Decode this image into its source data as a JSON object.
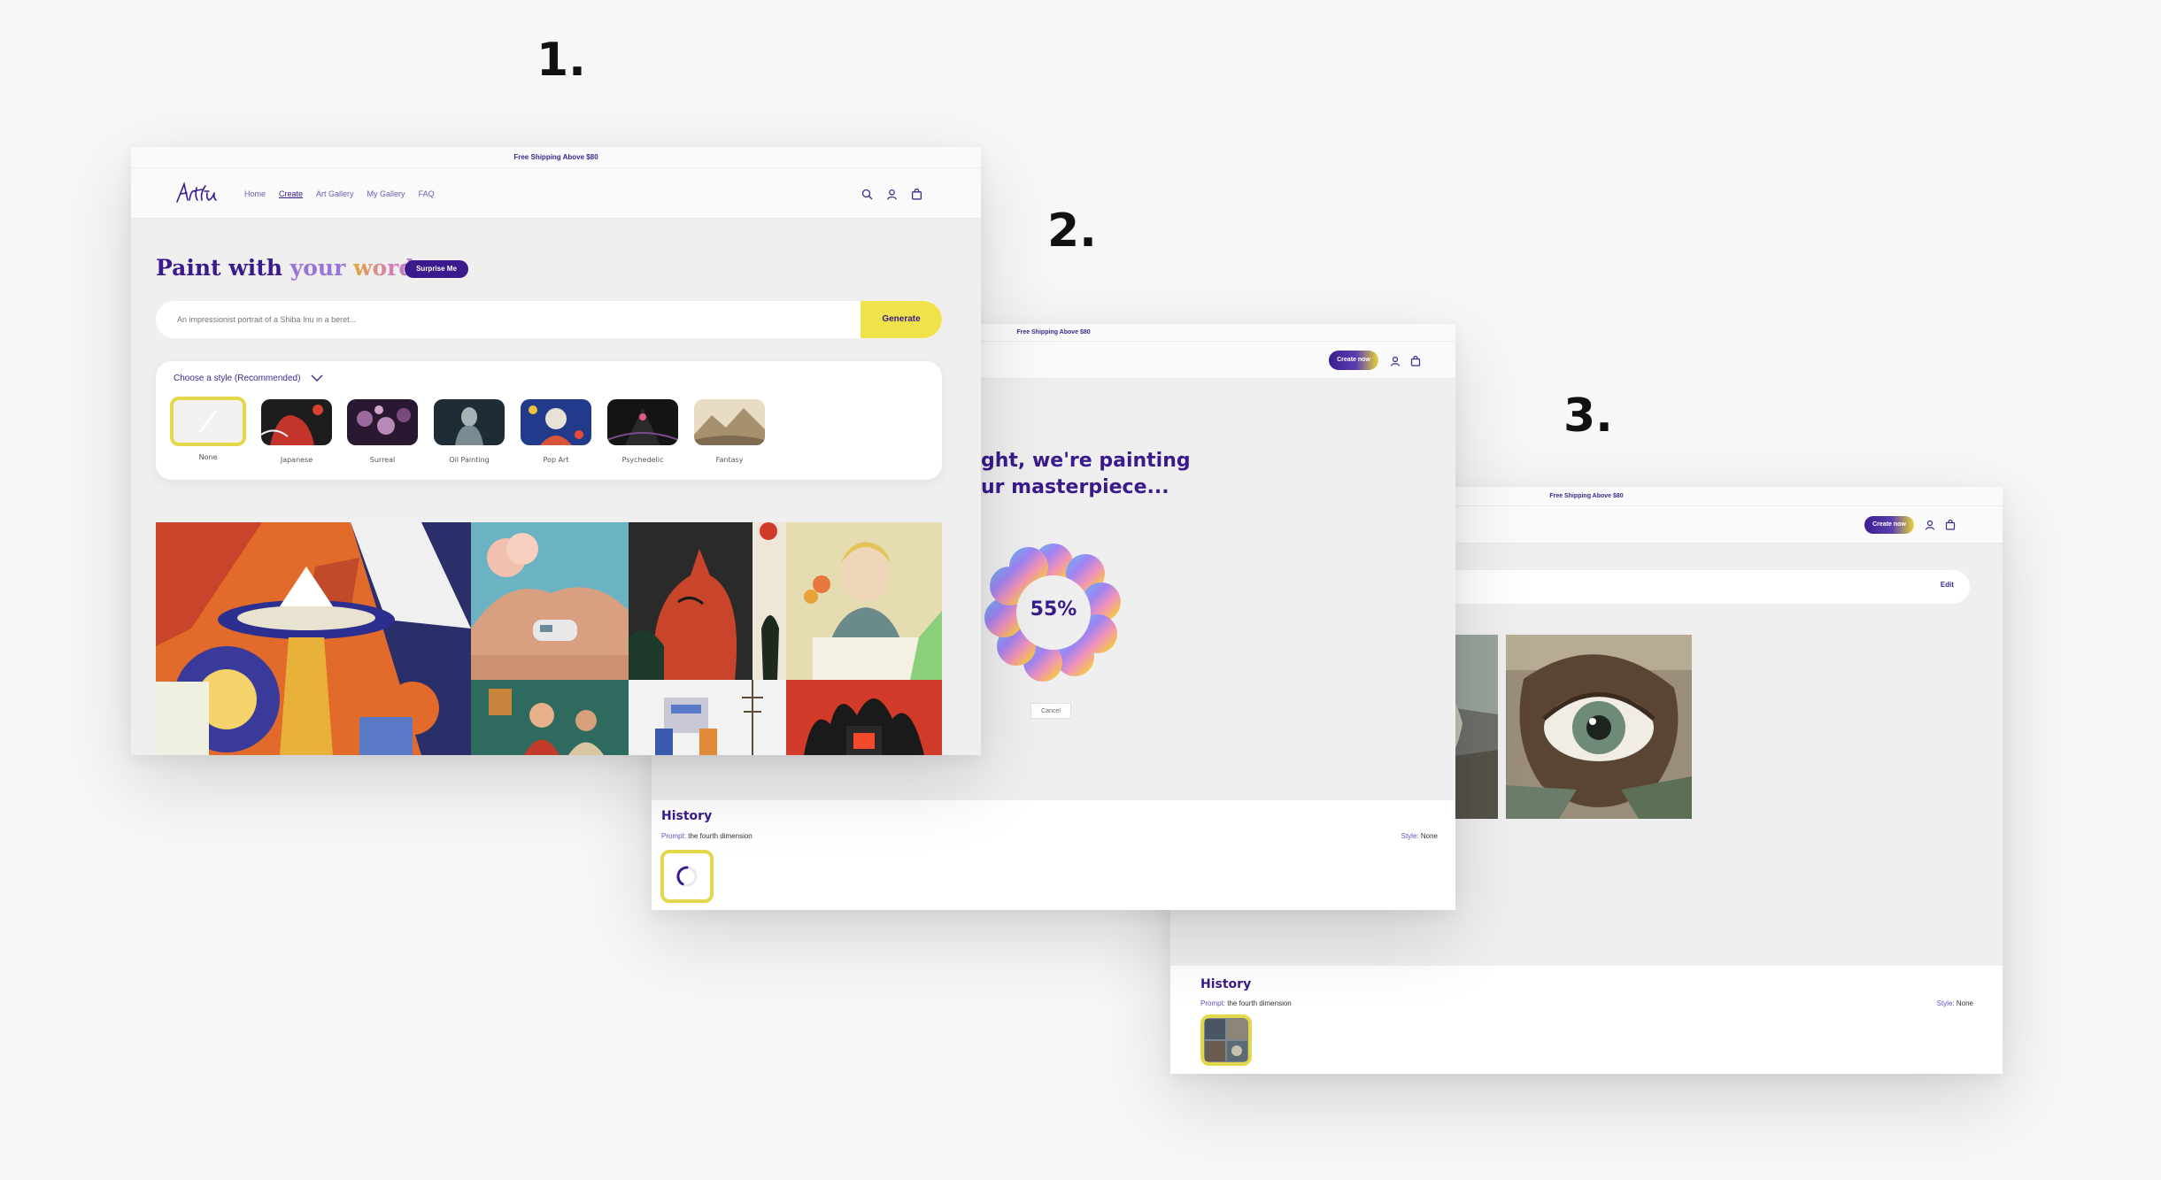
{
  "steps": [
    "1.",
    "2.",
    "3."
  ],
  "announcement": "Free Shipping Above $80",
  "nav": {
    "logo": "Artifici",
    "links": [
      "Home",
      "Create",
      "Art Gallery",
      "My Gallery",
      "FAQ"
    ],
    "create_now": "Create now"
  },
  "screen1": {
    "heading_1": "Paint with ",
    "heading_2": "your ",
    "heading_3": "words",
    "surprise_button": "Surprise Me",
    "prompt_placeholder": "An impressionist portrait of a Shiba Inu in a beret...",
    "generate_button": "Generate",
    "style_dropdown_label": "Choose a style (Recommended)",
    "styles": [
      "None",
      "Japanese",
      "Surreal",
      "Oil Painting",
      "Pop Art",
      "Psychedelic",
      "Fantasy"
    ],
    "selected_style": "None"
  },
  "screen2": {
    "headline_1": "ght, we're painting",
    "headline_2": "ur masterpiece...",
    "progress": 55,
    "progress_label": "55%",
    "cancel_button": "Cancel"
  },
  "screen3": {
    "edit_link": "Edit"
  },
  "history": {
    "title": "History",
    "prompt_label": "Prompt:",
    "prompt_value": "the fourth dimension",
    "style_label": "Style:",
    "style_value": "None"
  },
  "colors": {
    "brand_purple": "#3a1a8c",
    "accent_yellow": "#efe24a",
    "background": "#efefef"
  }
}
